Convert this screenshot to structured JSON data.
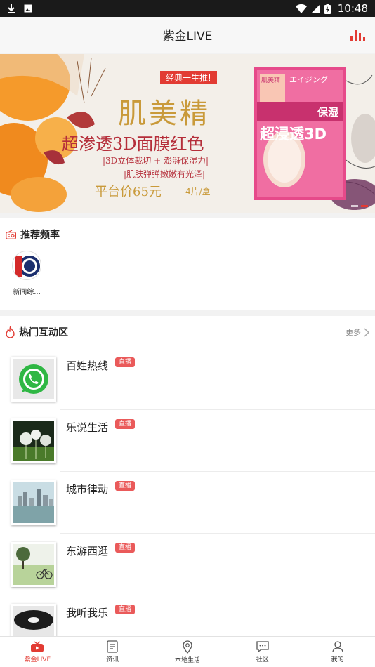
{
  "status_bar": {
    "time": "10:48"
  },
  "header": {
    "title": "紫金LIVE"
  },
  "banner": {
    "tag": "经典一生推!",
    "brand": "肌美精",
    "headline": "超渗透3D面膜红色",
    "line1": "|3D立体裁切 + 澎湃保湿力|",
    "line2": "|肌肤弹弹嫩嫩有光泽|",
    "price": "平台价65元",
    "unit": "4片/盒",
    "product_text": "超浸透3D",
    "product_side": "保湿",
    "product_top": "エイジング",
    "product_brand": "肌美精",
    "active_dot": 1,
    "total_dots": 2
  },
  "recommend": {
    "label": "推荐频率",
    "channels": [
      {
        "name": "新闻综..."
      }
    ]
  },
  "hot": {
    "label": "热门互动区",
    "more": "更多",
    "items": [
      {
        "name": "百姓热线",
        "badge": "直播"
      },
      {
        "name": "乐说生活",
        "badge": "直播"
      },
      {
        "name": "城市律动",
        "badge": "直播"
      },
      {
        "name": "东游西逛",
        "badge": "直播"
      },
      {
        "name": "我听我乐",
        "badge": "直播"
      }
    ]
  },
  "tabs": [
    {
      "label": "紫金LIVE",
      "icon": "tv-icon",
      "active": true
    },
    {
      "label": "资讯",
      "icon": "document-icon",
      "active": false
    },
    {
      "label": "本地生活",
      "icon": "location-icon",
      "active": false
    },
    {
      "label": "社区",
      "icon": "chat-icon",
      "active": false
    },
    {
      "label": "我的",
      "icon": "person-icon",
      "active": false
    }
  ],
  "colors": {
    "accent": "#e23b33",
    "badge": "#ea5a5a"
  }
}
